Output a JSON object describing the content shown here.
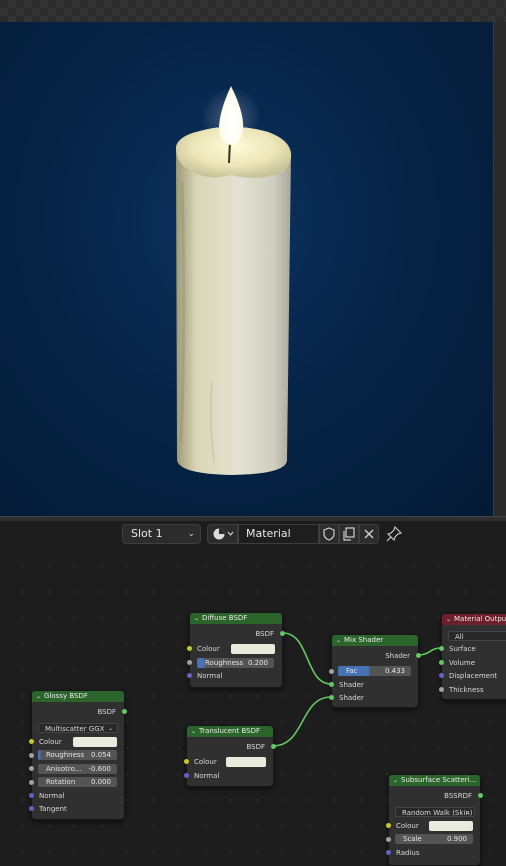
{
  "header": {
    "slot_label": "Slot 1",
    "material_name": "Material",
    "icons": [
      "sphere-material-icon",
      "fake-user-shield-icon",
      "duplicate-icon",
      "close-icon",
      "pin-icon"
    ]
  },
  "nodes": {
    "diffuse": {
      "title": "Diffuse BSDF",
      "out": "BSDF",
      "colour": "Colour",
      "roughness_label": "Roughness",
      "roughness_value": "0.200",
      "normal": "Normal"
    },
    "glossy": {
      "title": "Glossy BSDF",
      "out": "BSDF",
      "distribution": "Multiscatter GGX",
      "colour": "Colour",
      "roughness_label": "Roughness",
      "roughness_value": "0.054",
      "anisotropy_label": "Anisotro...",
      "anisotropy_value": "-0.600",
      "rotation_label": "Rotation",
      "rotation_value": "0.000",
      "normal": "Normal",
      "tangent": "Tangent"
    },
    "mix": {
      "title": "Mix Shader",
      "out": "Shader",
      "fac_label": "Fac",
      "fac_value": "0.433",
      "fac": 0.433,
      "in1": "Shader",
      "in2": "Shader"
    },
    "translucent": {
      "title": "Translucent BSDF",
      "out": "BSDF",
      "colour": "Colour",
      "normal": "Normal"
    },
    "output": {
      "title": "Material Output",
      "target": "All",
      "surface": "Surface",
      "volume": "Volume",
      "displacement": "Displacement",
      "thickness": "Thickness"
    },
    "sss": {
      "title": "Subsurface Scatteri...",
      "out": "BSSRDF",
      "method": "Random Walk (Skin)",
      "colour": "Colour",
      "scale_label": "Scale",
      "scale_value": "0.900",
      "radius": "Radius"
    }
  },
  "colors": {
    "node_header_shader": "#2b652b",
    "node_header_output": "#6e1f2c",
    "socket_shader": "#63c763",
    "socket_color": "#c7c729",
    "socket_float": "#a1a1a1",
    "socket_vector": "#6363c7",
    "viewport_background": "#062447"
  }
}
